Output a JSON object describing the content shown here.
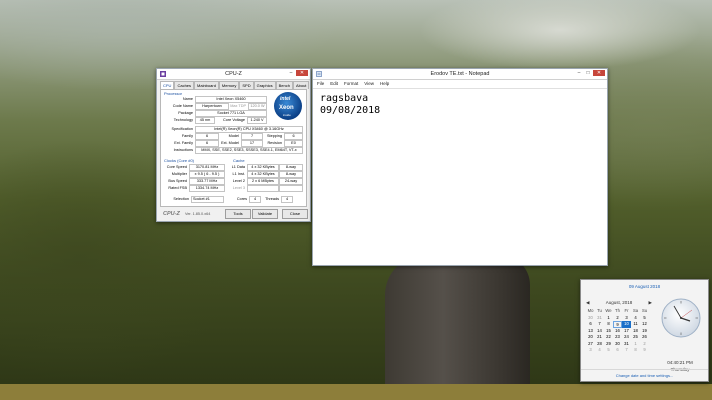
{
  "cpuz": {
    "title": "CPU-Z",
    "tabs": [
      "CPU",
      "Caches",
      "Mainboard",
      "Memory",
      "SPD",
      "Graphics",
      "Bench",
      "About"
    ],
    "processor_group": "Processor",
    "labels": {
      "name": "Name",
      "code_name": "Code Name",
      "max_tdp": "Max TDP",
      "package": "Package",
      "technology": "Technology",
      "core_voltage": "Core Voltage",
      "specification": "Specification",
      "family": "Family",
      "model": "Model",
      "stepping": "Stepping",
      "ext_family": "Ext. Family",
      "ext_model": "Ext. Model",
      "revision": "Revision",
      "instructions": "Instructions"
    },
    "values": {
      "name": "Intel Xeon X5460",
      "code_name": "Harpertown",
      "max_tdp": "120.0 W",
      "package": "Socket 771 LGA",
      "technology": "45 nm",
      "core_voltage": "1.240 V",
      "specification": "Intel(R) Xeon(R) CPU        X5460 @ 3.16GHz",
      "family": "6",
      "model": "7",
      "stepping": "6",
      "ext_family": "6",
      "ext_model": "17",
      "revision": "E0",
      "instructions": "MMX, SSE, SSE2, SSE3, SSSE3, SSE4.1, EM64T, VT-x"
    },
    "clocks_group": "Clocks (Core #0)",
    "cache_group": "Cache",
    "clocks": [
      {
        "label": "Core Speed",
        "value": "3170.81 MHz"
      },
      {
        "label": "Multiplier",
        "value": "x 9.5 ( 6 - 9.5 )"
      },
      {
        "label": "Bus Speed",
        "value": "333.77 MHz"
      },
      {
        "label": "Rated FSB",
        "value": "1334.74 MHz"
      }
    ],
    "cache": [
      {
        "label": "L1 Data",
        "value": "4 x 32 KBytes",
        "way": "8-way"
      },
      {
        "label": "L1 Inst.",
        "value": "4 x 32 KBytes",
        "way": "8-way"
      },
      {
        "label": "Level 2",
        "value": "2 x 6 MBytes",
        "way": "24-way"
      },
      {
        "label": "Level 3",
        "value": "",
        "way": ""
      }
    ],
    "selection_label": "Selection",
    "selection_value": "Socket #1",
    "cores_label": "Cores",
    "cores_value": "4",
    "threads_label": "Threads",
    "threads_value": "4",
    "logo": "CPU-Z",
    "version": "Ver. 1.85.0.x64",
    "tools_label": "Tools",
    "validate_label": "Validate",
    "close_label": "Close",
    "intel_badge": {
      "brand": "intel",
      "product": "Xeon",
      "tag": "inside"
    }
  },
  "notepad": {
    "title": "Erodov TE.txt - Notepad",
    "menu": [
      "File",
      "Edit",
      "Format",
      "View",
      "Help"
    ],
    "content": "ragsbava\n09/08/2018"
  },
  "clock_flyout": {
    "date_header": "09 August 2018",
    "month_label": "August, 2018",
    "weekdays": [
      "Mo",
      "Tu",
      "We",
      "Th",
      "Fr",
      "Sa",
      "Su"
    ],
    "days": [
      {
        "d": "30",
        "other": true
      },
      {
        "d": "31",
        "other": true
      },
      {
        "d": "1"
      },
      {
        "d": "2"
      },
      {
        "d": "3"
      },
      {
        "d": "4"
      },
      {
        "d": "5"
      },
      {
        "d": "6"
      },
      {
        "d": "7"
      },
      {
        "d": "8"
      },
      {
        "d": "9",
        "today": true
      },
      {
        "d": "10",
        "selected": true
      },
      {
        "d": "11"
      },
      {
        "d": "12"
      },
      {
        "d": "13"
      },
      {
        "d": "14"
      },
      {
        "d": "15"
      },
      {
        "d": "16"
      },
      {
        "d": "17"
      },
      {
        "d": "18"
      },
      {
        "d": "19"
      },
      {
        "d": "20"
      },
      {
        "d": "21"
      },
      {
        "d": "22"
      },
      {
        "d": "23"
      },
      {
        "d": "24"
      },
      {
        "d": "25"
      },
      {
        "d": "26"
      },
      {
        "d": "27"
      },
      {
        "d": "28"
      },
      {
        "d": "29"
      },
      {
        "d": "30"
      },
      {
        "d": "31"
      },
      {
        "d": "1",
        "other": true
      },
      {
        "d": "2",
        "other": true
      },
      {
        "d": "3",
        "other": true
      },
      {
        "d": "4",
        "other": true
      },
      {
        "d": "5",
        "other": true
      },
      {
        "d": "6",
        "other": true
      },
      {
        "d": "7",
        "other": true
      },
      {
        "d": "8",
        "other": true
      },
      {
        "d": "9",
        "other": true
      }
    ],
    "time": "04:40:21 PM",
    "day_name": "Thursday",
    "link": "Change date and time settings..."
  },
  "colors": {
    "accent": "#1a5fb4",
    "close_red": "#c7463b",
    "cpuz_blue": "#1a4fa0"
  }
}
